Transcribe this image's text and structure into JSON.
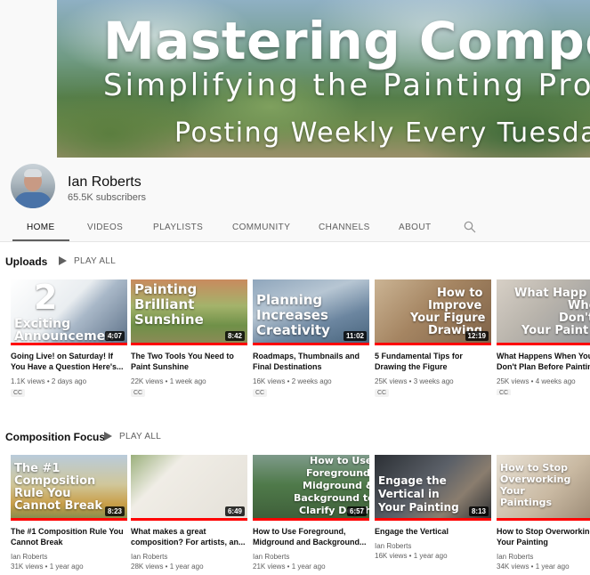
{
  "banner": {
    "title": "Mastering Compositi",
    "subtitle": "Simplifying the Painting Proc",
    "tagline": "Posting Weekly Every Tuesday"
  },
  "channel": {
    "name": "Ian Roberts",
    "subscribers": "65.5K subscribers"
  },
  "tabs": [
    "HOME",
    "VIDEOS",
    "PLAYLISTS",
    "COMMUNITY",
    "CHANNELS",
    "ABOUT"
  ],
  "active_tab": "HOME",
  "shelves": [
    {
      "title": "Uploads",
      "play_all": "PLAY ALL",
      "videos": [
        {
          "thumb_text": [
            "2",
            "Exciting",
            "Announcemen"
          ],
          "duration": "4:07",
          "title_lines": [
            "Going Live! on Saturday! If",
            "You Have a Question Here's..."
          ],
          "channel": "",
          "meta": "1.1K views • 2 days ago",
          "badge": "CC",
          "accent": "#3d6fa8"
        },
        {
          "thumb_text": [
            "Painting",
            "Brilliant",
            "Sunshine"
          ],
          "duration": "8:42",
          "title_lines": [
            "The Two Tools You Need to",
            "Paint Sunshine"
          ],
          "channel": "",
          "meta": "22K views • 1 week ago",
          "badge": "CC",
          "accent": "#8aa65a"
        },
        {
          "thumb_text": [
            "Planning",
            "Increases",
            "Creativity"
          ],
          "duration": "11:02",
          "title_lines": [
            "Roadmaps, Thumbnails and",
            "Final Destinations"
          ],
          "channel": "",
          "meta": "16K views • 2 weeks ago",
          "badge": "CC",
          "accent": "#6d8fb0"
        },
        {
          "thumb_text": [
            "How to",
            "Improve",
            "Your Figure",
            "Drawing"
          ],
          "duration": "12:19",
          "title_lines": [
            "5 Fundamental Tips for",
            "Drawing the Figure"
          ],
          "channel": "",
          "meta": "25K views • 3 weeks ago",
          "badge": "CC",
          "accent": "#b89468"
        },
        {
          "thumb_text": [
            "What Happ",
            "When",
            "Don't P",
            "Your Paint"
          ],
          "duration": "",
          "title_lines": [
            "What Happens When You",
            "Don't Plan Before Painting"
          ],
          "channel": "",
          "meta": "25K views • 4 weeks ago",
          "badge": "CC",
          "accent": "#9aa0a8"
        }
      ]
    },
    {
      "title": "Composition Focus",
      "play_all": "PLAY ALL",
      "videos": [
        {
          "thumb_text": [
            "The #1",
            "Composition",
            "Rule You",
            "Cannot Break"
          ],
          "duration": "8:23",
          "title_lines": [
            "The #1 Composition Rule You",
            "Cannot Break"
          ],
          "channel": "Ian Roberts",
          "meta": "31K views • 1 year ago",
          "badge": "",
          "accent": "#9bb0c0"
        },
        {
          "thumb_text": [],
          "duration": "6:49",
          "title_lines": [
            "What makes a great",
            "composition? For artists, an..."
          ],
          "channel": "Ian Roberts",
          "meta": "28K views • 1 year ago",
          "badge": "",
          "accent": "#e8e4dc"
        },
        {
          "thumb_text": [
            "How to Use",
            "Foreground,",
            "Midground &",
            "Background to",
            "Clarify Depth"
          ],
          "duration": "6:57",
          "title_lines": [
            "How to Use Foreground,",
            "Midground and Background..."
          ],
          "channel": "Ian Roberts",
          "meta": "21K views • 1 year ago",
          "badge": "",
          "accent": "#4f7a4a"
        },
        {
          "thumb_text": [
            "Engage the",
            "Vertical in",
            "Your Painting"
          ],
          "duration": "8:13",
          "title_lines": [
            "Engage the Vertical"
          ],
          "channel": "Ian Roberts",
          "meta": "16K views • 1 year ago",
          "badge": "",
          "accent": "#3b4048"
        },
        {
          "thumb_text": [
            "How to Stop",
            "Overworking",
            "Your",
            "Paintings"
          ],
          "duration": "",
          "title_lines": [
            "How to Stop Overworking",
            "Your Painting"
          ],
          "channel": "Ian Roberts",
          "meta": "34K views • 1 year ago",
          "badge": "",
          "accent": "#c8b8a0"
        }
      ]
    }
  ],
  "icons": {
    "search": "search-icon",
    "play_all": "play-icon"
  }
}
